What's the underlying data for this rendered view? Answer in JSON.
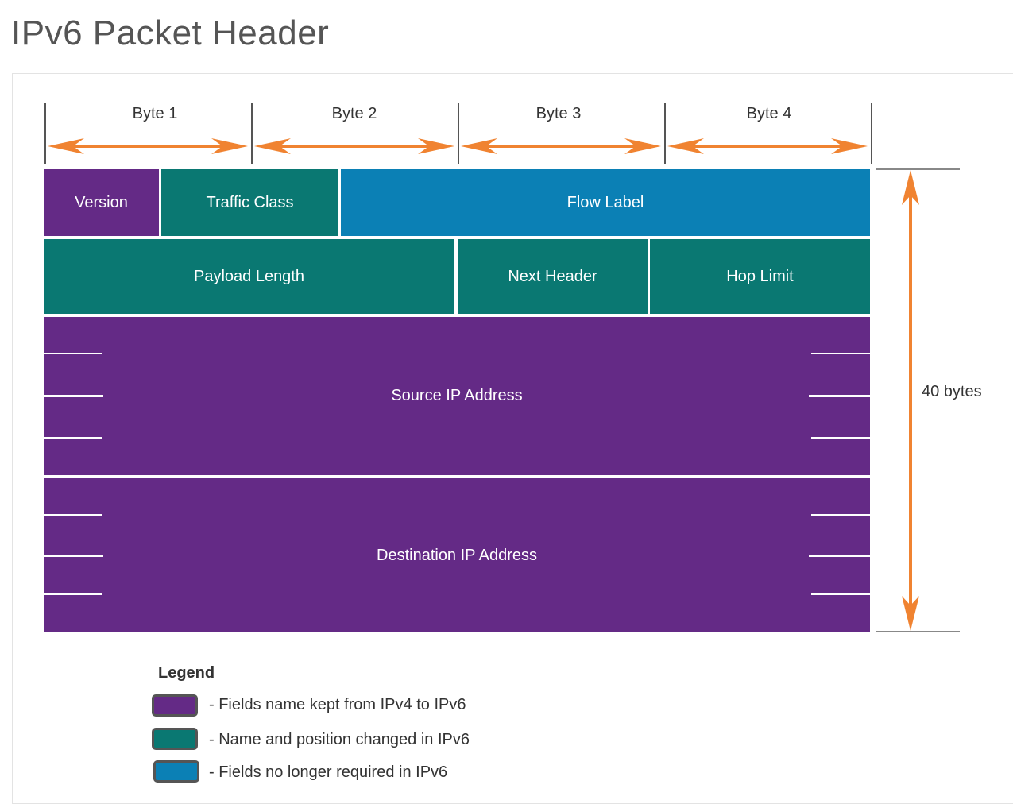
{
  "title": "IPv6 Packet Header",
  "colors": {
    "purple": "#642a86",
    "teal": "#0a7872",
    "blue": "#0b80b5",
    "arrow": "#f08331"
  },
  "bytes": [
    "Byte 1",
    "Byte 2",
    "Byte 3",
    "Byte 4"
  ],
  "fields": {
    "version": "Version",
    "traffic_class": "Traffic Class",
    "flow_label": "Flow Label",
    "payload_length": "Payload Length",
    "next_header": "Next Header",
    "hop_limit": "Hop Limit",
    "source_ip": "Source IP Address",
    "destination_ip": "Destination IP Address"
  },
  "size_label": "40 bytes",
  "legend": {
    "title": "Legend",
    "items": [
      {
        "color": "purple",
        "text": "- Fields name kept from IPv4 to IPv6"
      },
      {
        "color": "teal",
        "text": "- Name and position changed in IPv6"
      },
      {
        "color": "blue",
        "text": "- Fields no longer required in IPv6"
      }
    ]
  }
}
